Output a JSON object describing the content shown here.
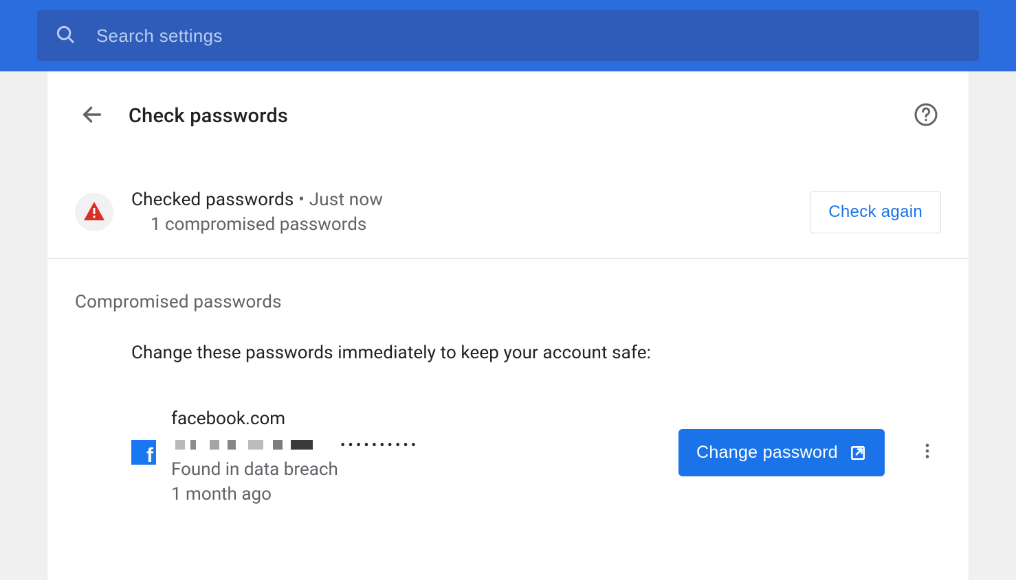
{
  "search": {
    "placeholder": "Search settings"
  },
  "page": {
    "title": "Check passwords"
  },
  "status": {
    "label": "Checked passwords",
    "sep": " • ",
    "time": "Just now",
    "summary": "1 compromised passwords",
    "check_again_label": "Check again"
  },
  "compromised": {
    "heading": "Compromised passwords",
    "description": "Change these passwords immediately to keep your account safe:",
    "items": [
      {
        "site": "facebook.com",
        "masked_password": "••••••••••",
        "found_label": "Found in data breach",
        "age": "1 month ago",
        "change_label": "Change password"
      }
    ]
  }
}
